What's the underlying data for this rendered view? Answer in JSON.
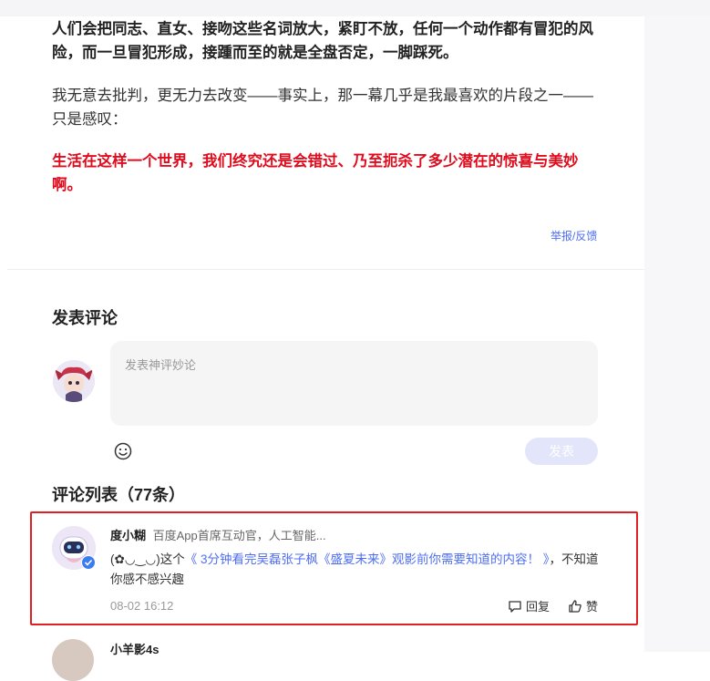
{
  "article": {
    "para1": "人们会把同志、直女、接吻这些名词放大，紧盯不放，任何一个动作都有冒犯的风险，而一旦冒犯形成，接踵而至的就是全盘否定，一脚踩死。",
    "para2": "我无意去批判，更无力去改变——事实上，那一幕几乎是我最喜欢的片段之一——只是感叹：",
    "para3": "生活在这样一个世界，我们终究还是会错过、乃至扼杀了多少潜在的惊喜与美妙啊。",
    "report_label": "举报/反馈"
  },
  "post_comment": {
    "title": "发表评论",
    "placeholder": "发表神评妙论",
    "submit_label": "发表",
    "emoji_icon": "smiley-icon"
  },
  "comments": {
    "title": "评论列表（77条）",
    "items": [
      {
        "username": "度小糊",
        "description": "百度App首席互动官，人工智能...",
        "text_prefix": "(✿◡‿◡)这个",
        "link_text": "《 3分钟看完吴磊张子枫《盛夏未来》观影前你需要知道的内容！ 》",
        "text_suffix": "，不知道你感不感兴趣",
        "time": "08-02 16:12",
        "reply_label": "回复",
        "like_label": "赞"
      },
      {
        "username": "小羊影4s"
      }
    ]
  },
  "colors": {
    "accent": "#4e6ef2",
    "highlight_red": "#e00b1c",
    "submit_disabled": "#e3e5fb"
  }
}
